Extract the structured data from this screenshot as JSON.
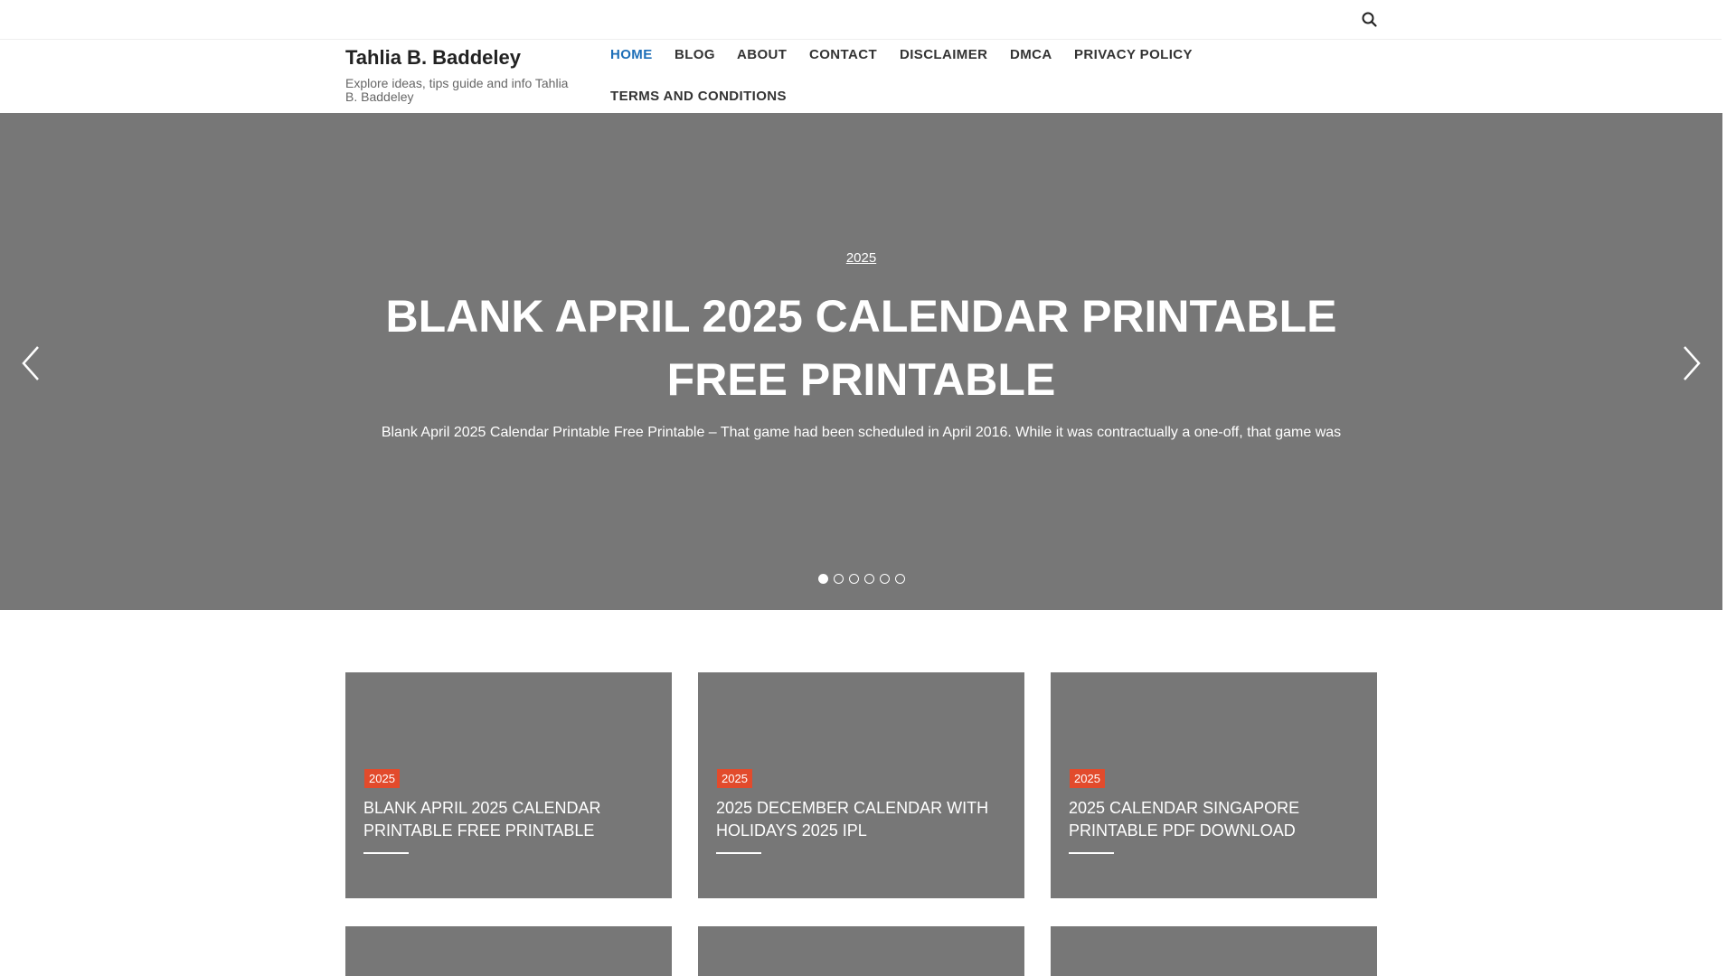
{
  "site": {
    "title": "Tahlia B. Baddeley",
    "description": "Explore ideas, tips guide and info Tahlia B. Baddeley"
  },
  "nav": {
    "items": [
      {
        "label": "HOME",
        "active": true
      },
      {
        "label": "BLOG"
      },
      {
        "label": "ABOUT"
      },
      {
        "label": "CONTACT"
      },
      {
        "label": "DISCLAIMER"
      },
      {
        "label": "DMCA"
      },
      {
        "label": "PRIVACY POLICY"
      },
      {
        "label": "TERMS AND CONDITIONS"
      }
    ]
  },
  "search": {
    "icon": "search-icon"
  },
  "slider": {
    "category": "2025",
    "title": "BLANK APRIL 2025 CALENDAR PRINTABLE FREE PRINTABLE",
    "excerpt": "Blank April 2025 Calendar Printable Free Printable – That game had been scheduled in April 2016. While it was contractually a one-off, that game was",
    "dots": [
      "1",
      "2",
      "3",
      "4",
      "5",
      "6"
    ],
    "active_dot": 1,
    "prev_icon": "chevron-left-icon",
    "next_icon": "chevron-right-icon"
  },
  "cards": [
    {
      "category": "2025",
      "title": "BLANK APRIL 2025 CALENDAR PRINTABLE FREE PRINTABLE"
    },
    {
      "category": "2025",
      "title": "2025 DECEMBER CALENDAR WITH HOLIDAYS 2025 IPL"
    },
    {
      "category": "2025",
      "title": "2025 CALENDAR SINGAPORE PRINTABLE PDF DOWNLOAD"
    }
  ],
  "colors": {
    "active_nav": "#1e6fb8",
    "badge": "#e24b2c",
    "placeholder_gray": "#777777"
  }
}
